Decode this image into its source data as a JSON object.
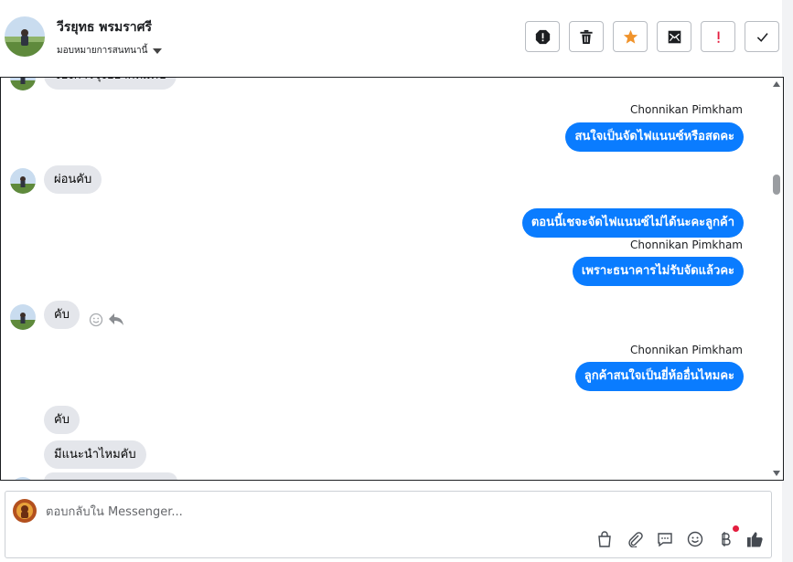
{
  "header": {
    "contact_name": "วีรยุทธ พรมราศรี",
    "assign_label": "มอบหมายการสนทนานี้",
    "actions": [
      {
        "name": "report-icon",
        "color": "#1c1e21"
      },
      {
        "name": "trash-icon",
        "color": "#1c1e21"
      },
      {
        "name": "star-icon",
        "color": "#f0932b"
      },
      {
        "name": "mail-icon",
        "color": "#1c1e21"
      },
      {
        "name": "exclamation-icon",
        "color": "#e41e3f"
      },
      {
        "name": "check-icon",
        "color": "#1c1e21"
      }
    ]
  },
  "conversation": {
    "agent_name": "Chonnikan Pimkham",
    "messages": [
      {
        "from": "customer",
        "text": "จองการจุงอยากทมคบ"
      },
      {
        "from": "agent",
        "sender": "Chonnikan Pimkham",
        "text": "สนใจเป็นจัดไฟแนนซ์หรือสดคะ"
      },
      {
        "from": "customer",
        "text": "ผ่อนคับ"
      },
      {
        "from": "agent",
        "text": "ตอนนี้เชจะจัดไฟแนนซ์ไม่ได้นะคะลูกค้า"
      },
      {
        "from": "agent",
        "sender": "Chonnikan Pimkham",
        "text": "เพราะธนาคารไม่รับจัดแล้วคะ"
      },
      {
        "from": "customer",
        "text": "คับ"
      },
      {
        "from": "agent",
        "sender": "Chonnikan Pimkham",
        "text": "ลูกค้าสนใจเป็นยี่ห้ออื่นไหมคะ"
      },
      {
        "from": "customer",
        "text": "คับ"
      },
      {
        "from": "customer",
        "text": "มีแนะนำไหมคับ"
      }
    ]
  },
  "composer": {
    "placeholder": "ตอบกลับใน Messenger...",
    "tools": [
      "bag-icon",
      "paperclip-icon",
      "comment-icon",
      "smile-icon",
      "baht-icon",
      "thumbs-up-icon"
    ],
    "notification_color": "#e41e3f",
    "accent": "#0a7cff"
  }
}
